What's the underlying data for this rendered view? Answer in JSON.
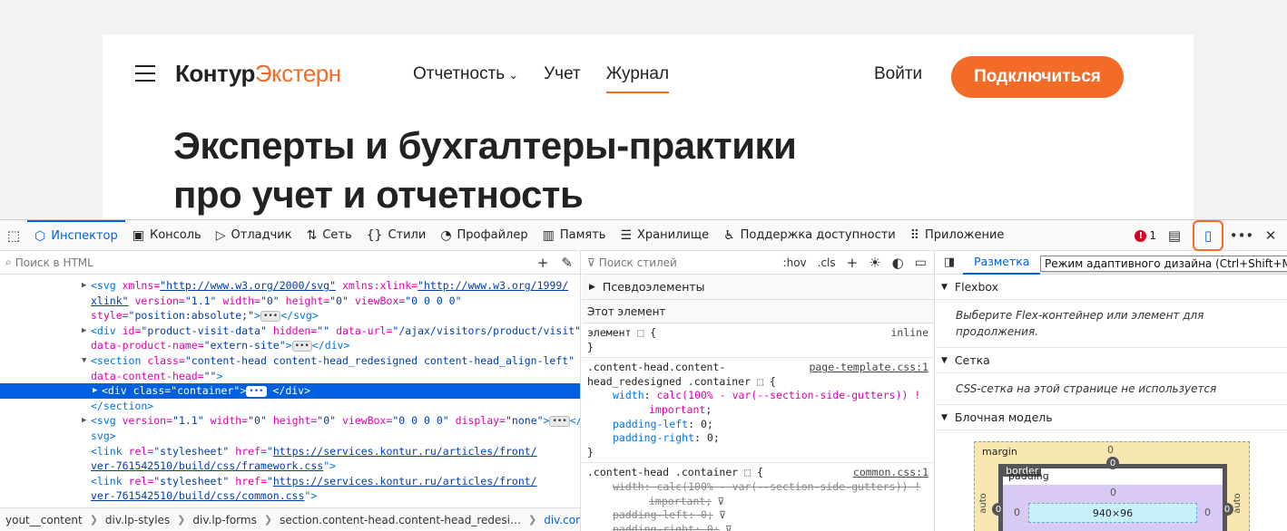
{
  "site": {
    "logo_bold": "Контур",
    "logo_orange": "Экстерн",
    "nav": [
      {
        "label": "Отчетность",
        "has_dropdown": true,
        "active": false
      },
      {
        "label": "Учет",
        "has_dropdown": false,
        "active": false
      },
      {
        "label": "Журнал",
        "has_dropdown": false,
        "active": true
      }
    ],
    "login": "Войти",
    "connect": "Подключиться",
    "hero_line1": "Эксперты и бухгалтеры-практики",
    "hero_line2": "про учет и отчетность",
    "accent_color": "#f26c28"
  },
  "devtools": {
    "tabs": [
      {
        "label": "Инспектор",
        "icon": "inspector-icon",
        "active": true
      },
      {
        "label": "Консоль",
        "icon": "console-icon"
      },
      {
        "label": "Отладчик",
        "icon": "debugger-icon"
      },
      {
        "label": "Сеть",
        "icon": "network-icon"
      },
      {
        "label": "Стили",
        "icon": "style-editor-icon"
      },
      {
        "label": "Профайлер",
        "icon": "profiler-icon"
      },
      {
        "label": "Память",
        "icon": "memory-icon"
      },
      {
        "label": "Хранилище",
        "icon": "storage-icon"
      },
      {
        "label": "Поддержка доступности",
        "icon": "accessibility-icon"
      },
      {
        "label": "Приложение",
        "icon": "application-icon"
      }
    ],
    "error_count": "1",
    "html_search_placeholder": "Поиск в HTML",
    "styles_search_placeholder": "Поиск стилей",
    "hov": ":hov",
    "cls": ".cls",
    "pseudo_elements": "Псевдоэлементы",
    "this_element": "Этот элемент",
    "breadcrumbs": [
      "yout__content",
      "div.lp-styles",
      "div.lp-forms",
      "section.content-head.content-head_redesi…",
      "div.container"
    ],
    "layout_tab": "Разметка",
    "tooltip": "Режим адаптивного дизайна (Ctrl+Shift+M)",
    "flexbox": "Flexbox",
    "flexbox_note": "Выберите Flex-контейнер или элемент для продолжения.",
    "grid": "Сетка",
    "grid_note": "CSS-сетка на этой странице не используется",
    "box_model": "Блочная модель",
    "box": {
      "margin_label": "margin",
      "border_label": "border",
      "padding_label": "padding",
      "margin_top": "0",
      "border_top": "0",
      "padding_top": "0",
      "margin_side": "auto",
      "border_left": "0",
      "padding_left": "0",
      "padding_right": "0",
      "border_right": "0",
      "content": "940×96"
    }
  },
  "rules": {
    "element_selector": "элемент",
    "element_source": "inline",
    "rule1_selector_a": ".content-head.content-",
    "rule1_selector_b": "head_redesigned .container",
    "rule1_source": "page-template.css:1",
    "rule1_p1_name": "width",
    "rule1_p1_val": "calc(100% - var(--section-side-gutters)) !",
    "rule1_p1_imp": "important",
    "rule1_p2_name": "padding-left",
    "rule1_p2_val": "0",
    "rule1_p3_name": "padding-right",
    "rule1_p3_val": "0",
    "rule2_selector": ".content-head .container",
    "rule2_source": "common.css:1",
    "rule2_p1_name": "width",
    "rule2_p1_val": "calc(100% - var(--section-side-gutters)) !",
    "rule2_p1_imp": "important",
    "rule2_p2_name": "padding-left",
    "rule2_p2_val": "0",
    "rule2_p3_name": "padding-right",
    "rule2_p3_val": "0"
  },
  "tree": {
    "n1_a": "<svg ",
    "n1_b": "xmlns=",
    "n1_c": "\"http://www.w3.org/2000/svg\"",
    "n1_d": " xmlns:xlink=",
    "n1_e": "\"http://www.w3.org/1999/",
    "n1_f": "xlink\"",
    "n1_g": " version=",
    "n1_h": "\"1.1\"",
    "n1_i": " width=",
    "n1_j": "\"0\"",
    "n1_k": " height=",
    "n1_l": "\"0\"",
    "n1_m": " viewBox=",
    "n1_n": "\"0 0 0 0\"",
    "n1_o": "style=",
    "n1_p": "\"position:absolute;\"",
    "n1_q": ">",
    "n1_r": "</svg>",
    "n2_a": "<div ",
    "n2_b": "id=",
    "n2_c": "\"product-visit-data\"",
    "n2_d": " hidden=",
    "n2_e": "\"\"",
    "n2_f": " data-url=",
    "n2_g": "\"/ajax/visitors/product/visit\"",
    "n2_h": "data-product-name=",
    "n2_i": "\"extern-site\"",
    "n2_j": ">",
    "n2_k": "</div>",
    "n3_a": "<section ",
    "n3_b": "class=",
    "n3_c": "\"content-head content-head_redesigned content-head_align-left\"",
    "n3_d": "data-content-head=",
    "n3_e": "\"\"",
    "n3_f": ">",
    "n4_a": "<div ",
    "n4_b": "class=",
    "n4_c": "\"container\"",
    "n4_d": ">",
    "n4_e": "</div>",
    "n5": "</section>",
    "n6_a": "<svg ",
    "n6_b": "version=",
    "n6_c": "\"1.1\"",
    "n6_d": " width=",
    "n6_e": "\"0\"",
    "n6_f": " height=",
    "n6_g": "\"0\"",
    "n6_h": " viewBox=",
    "n6_i": "\"0 0 0 0\"",
    "n6_j": " display=",
    "n6_k": "\"none\"",
    "n6_l": ">",
    "n6_m": "</",
    "n6_n": "svg>",
    "n7_a": "<link ",
    "n7_b": "rel=",
    "n7_c": "\"stylesheet\"",
    "n7_d": " href=",
    "n7_e": "\"",
    "n7_f": "https://services.kontur.ru/articles/front/",
    "n7_g": "ver-761542510/build/css/framework.css",
    "n7_h": "\">",
    "n8_f": "https://services.kontur.ru/articles/front/",
    "n8_g": "ver-761542510/build/css/common.css",
    "badge": "•••"
  }
}
